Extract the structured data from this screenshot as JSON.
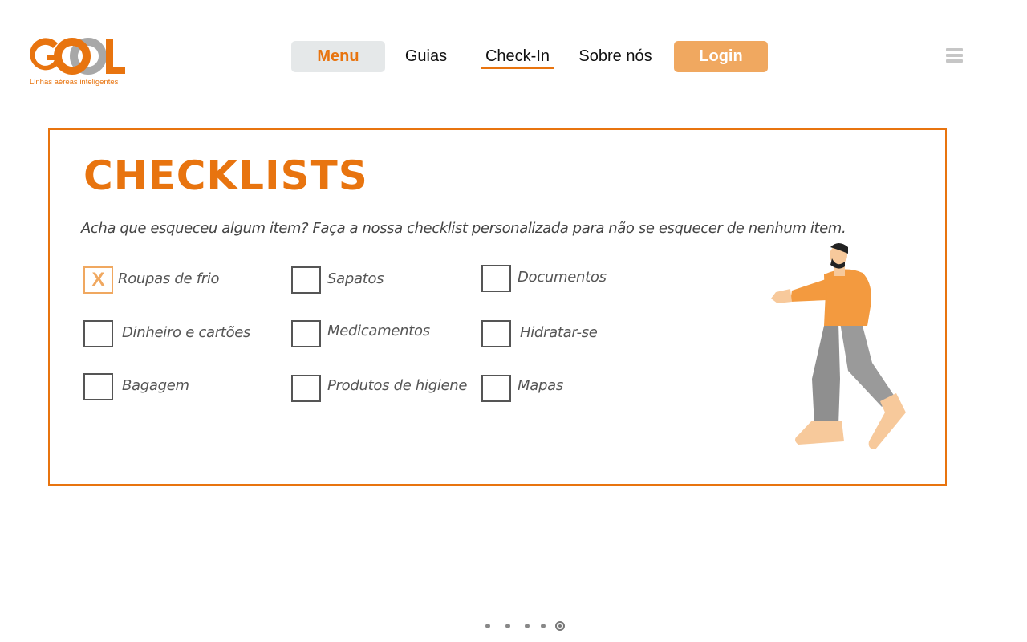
{
  "logo": {
    "wordmark": "GOOL",
    "tagline": "Linhas aéreas inteligentes",
    "colors": {
      "primary": "#e8740f",
      "secondary": "#a8a8a8"
    }
  },
  "nav": {
    "items": [
      {
        "label": "Menu",
        "state": "highlighted"
      },
      {
        "label": "Guias"
      },
      {
        "label": "Check-In",
        "state": "active"
      },
      {
        "label": "Sobre nós"
      }
    ],
    "login_label": "Login",
    "menu_icon": "hamburger-icon"
  },
  "checklist": {
    "title": "CHECKLISTS",
    "subtitle": "Acha que esqueceu algum item? Faça a nossa checklist personalizada para não se esquecer de nenhum item.",
    "items": [
      {
        "label": "Roupas de frio",
        "checked": true,
        "mark": "X"
      },
      {
        "label": "Sapatos",
        "checked": false
      },
      {
        "label": "Documentos",
        "checked": false
      },
      {
        "label": "Dinheiro e cartões",
        "checked": false
      },
      {
        "label": "Medicamentos",
        "checked": false
      },
      {
        "label": "Hidratar-se",
        "checked": false
      },
      {
        "label": "Bagagem",
        "checked": false
      },
      {
        "label": "Produtos de higiene",
        "checked": false
      },
      {
        "label": "Mapas",
        "checked": false
      }
    ],
    "illustration": "man-walking-illustration"
  },
  "pager": {
    "total": 5,
    "active": 5
  },
  "colors": {
    "accent": "#e8740f",
    "login_bg": "#f0a860",
    "menu_bg": "#e5e8e9"
  }
}
